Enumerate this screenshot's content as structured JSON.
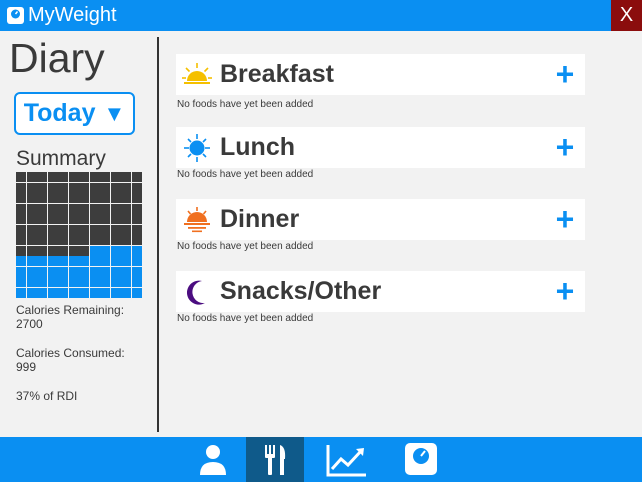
{
  "app": {
    "title": "MyWeight",
    "close_label": "X"
  },
  "sidebar": {
    "title": "Diary",
    "date_selector": {
      "value": "Today",
      "caret": "▼"
    },
    "summary_title": "Summary",
    "grid": {
      "total_cells": 144,
      "consumed_fraction": 0.37
    },
    "calories_remaining_label": "Calories Remaining:",
    "calories_remaining_value": "2700",
    "calories_consumed_label": "Calories Consumed:",
    "calories_consumed_value": "999",
    "rdi_text": "37% of RDI"
  },
  "meals": [
    {
      "name": "Breakfast",
      "icon": "sunrise-icon",
      "empty_text": "No foods have yet been added",
      "add_label": "+"
    },
    {
      "name": "Lunch",
      "icon": "sun-icon",
      "empty_text": "No foods have yet been added",
      "add_label": "+"
    },
    {
      "name": "Dinner",
      "icon": "sunset-icon",
      "empty_text": "No foods have yet been added",
      "add_label": "+"
    },
    {
      "name": "Snacks/Other",
      "icon": "moon-icon",
      "empty_text": "No foods have yet been added",
      "add_label": "+"
    }
  ],
  "nav": [
    {
      "name": "profile",
      "icon": "person-icon",
      "active": false
    },
    {
      "name": "diary",
      "icon": "fork-knife-icon",
      "active": true
    },
    {
      "name": "progress",
      "icon": "chart-trend-icon",
      "active": false
    },
    {
      "name": "weigh-in",
      "icon": "scale-icon",
      "active": false
    }
  ],
  "colors": {
    "accent": "#0a8ff2",
    "close": "#8b0d0d",
    "consumed": "#3d3d3d",
    "active_nav": "#0f5a8a"
  }
}
